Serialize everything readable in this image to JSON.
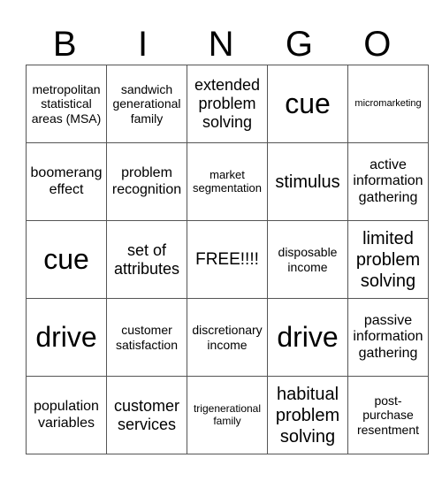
{
  "header": [
    "B",
    "I",
    "N",
    "G",
    "O"
  ],
  "cells": [
    [
      "metropolitan statistical areas (MSA)",
      "sandwich generational family",
      "extended problem solving",
      "cue",
      "micromarketing"
    ],
    [
      "boomerang effect",
      "problem recognition",
      "market segmentation",
      "stimulus",
      "active information gathering"
    ],
    [
      "cue",
      "set of attributes",
      "FREE!!!!",
      "disposable income",
      "limited problem solving"
    ],
    [
      "drive",
      "customer satisfaction",
      "discretionary income",
      "drive",
      "passive information gathering"
    ],
    [
      "population variables",
      "customer services",
      "trigenerational family",
      "habitual problem solving",
      "post-purchase resentment"
    ]
  ]
}
